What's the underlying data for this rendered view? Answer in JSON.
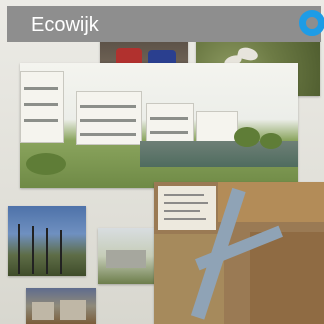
{
  "tile": {
    "title": "Ecowijk",
    "colors": {
      "title_bar": "#8e8e8e",
      "title_text": "#ffffff",
      "accent_badge": "#1e9ce6"
    },
    "icons": {
      "badge": "ring-badge-icon"
    }
  }
}
